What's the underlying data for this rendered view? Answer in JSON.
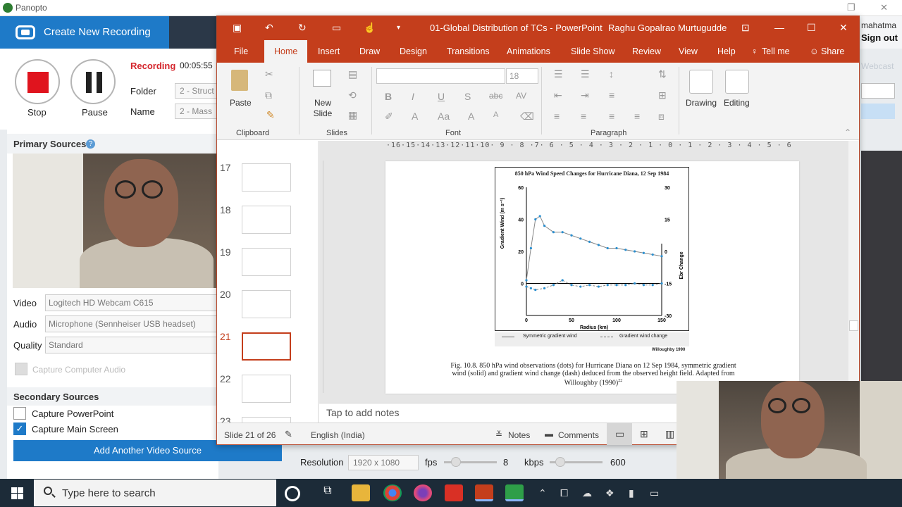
{
  "panopto": {
    "title": "Panopto",
    "create_label": "Create New Recording",
    "user": "mahatma",
    "signout": "Sign out",
    "stop_label": "Stop",
    "pause_label": "Pause",
    "status": "Recording",
    "elapsed": "00:05:55",
    "folder_label": "Folder",
    "folder_value": "2 - Struct",
    "name_label": "Name",
    "name_value": "2 - Mass",
    "primary_sources": "Primary Sources",
    "video_label": "Video",
    "video_value": "Logitech HD Webcam C615",
    "audio_label": "Audio",
    "audio_value": "Microphone (Sennheiser USB headset)",
    "quality_label": "Quality",
    "quality_value": "Standard",
    "capture_audio": "Capture Computer Audio",
    "secondary_sources": "Secondary Sources",
    "capture_ppt": "Capture PowerPoint",
    "capture_screen": "Capture Main Screen",
    "add_source": "Add Another Video Source",
    "webcast": "Webcast",
    "resolution_label": "Resolution",
    "resolution_value": "1920 x 1080",
    "fps_label": "fps",
    "fps_value": "8",
    "kbps_label": "kbps",
    "kbps_value": "600"
  },
  "ppt": {
    "doc_title": "01-Global Distribution of TCs  -  PowerPoint",
    "user": "Raghu Gopalrao Murtugudde",
    "tabs": [
      "File",
      "Home",
      "Insert",
      "Draw",
      "Design",
      "Transitions",
      "Animations",
      "Slide Show",
      "Review",
      "View",
      "Help",
      "Tell me",
      "Share"
    ],
    "ribbon": {
      "paste": "Paste",
      "new_slide": "New Slide",
      "font_size": "18",
      "drawing": "Drawing",
      "editing": "Editing",
      "groups": [
        "Clipboard",
        "Slides",
        "Font",
        "Paragraph"
      ]
    },
    "thumb_numbers": [
      "17",
      "18",
      "19",
      "20",
      "21",
      "22",
      "23"
    ],
    "ruler": "·16·15·14·13·12·11·10· 9 · 8 ·7· 6 · 5 · 4 · 3 · 2 · 1 · 0 · 1 · 2 · 3 · 4 · 5 · 6 · 7 · 8 · 9 ·10·11·12·13·14·15·16·",
    "notes_placeholder": "Tap to add notes",
    "status": {
      "slide": "Slide 21 of 26",
      "language": "English (India)",
      "notes": "Notes",
      "comments": "Comments"
    },
    "slide": {
      "caption": "Fig. 10.8. 850 hPa wind observations (dots) for Hurricane Diana on 12 Sep 1984, symmetric gradient wind (solid) and gradient wind change (dash) deduced from the observed height field. Adapted from Willoughby (1990)",
      "caption_ref": "22",
      "credit": "Willoughby 1990"
    }
  },
  "chart_data": {
    "type": "line",
    "title": "850 hPa Wind Speed Changes for Hurricane Diana, 12 Sep 1984",
    "xlabel": "Radius (km)",
    "ylabel": "Gradient Wind (m s⁻¹)",
    "y2label": "Ebr Change",
    "xlim": [
      0,
      150
    ],
    "ylim": [
      -20,
      60
    ],
    "y2lim": [
      -30,
      30
    ],
    "x_ticks": [
      "0",
      "50",
      "100",
      "150"
    ],
    "y_ticks": [
      "0",
      "20",
      "40",
      "60"
    ],
    "y2_ticks": [
      "-30",
      "-15",
      "0",
      "15",
      "30"
    ],
    "legend": [
      "Symmetric gradient wind",
      "Gradient wind change"
    ],
    "series": [
      {
        "name": "Symmetric gradient wind",
        "x": [
          0,
          5,
          10,
          15,
          20,
          30,
          40,
          50,
          60,
          70,
          80,
          90,
          100,
          110,
          120,
          130,
          140,
          150
        ],
        "y": [
          2,
          22,
          40,
          42,
          36,
          32,
          32,
          30,
          28,
          26,
          24,
          22,
          22,
          21,
          20,
          19,
          18,
          17
        ]
      },
      {
        "name": "Gradient wind change",
        "x": [
          0,
          5,
          10,
          20,
          30,
          40,
          50,
          60,
          70,
          80,
          90,
          100,
          110,
          120,
          130,
          140,
          150
        ],
        "y": [
          -2,
          -3,
          -4,
          -3,
          -1,
          2,
          -1,
          -2,
          -1,
          -2,
          -1,
          -1,
          -1,
          0,
          -1,
          -1,
          0
        ]
      }
    ]
  },
  "taskbar": {
    "search_placeholder": "Type here to search"
  }
}
